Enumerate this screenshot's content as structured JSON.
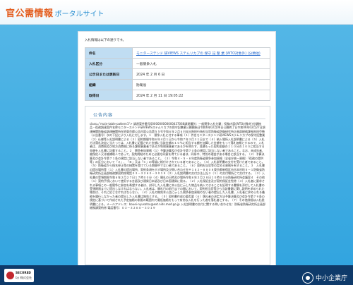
{
  "header": {
    "title_main": "官公需情報",
    "title_sub": "ポータルサイト"
  },
  "card": {
    "note": "入札情報は以下の通りです。",
    "rows": [
      {
        "key": "件名",
        "value": "モニターステンド 研VIEWS ステムリカプの 保守 記 整 業 (WTO対象外) (分類他)",
        "link": true
      },
      {
        "key": "入札区分",
        "value": "一般競争入札",
        "link": false
      },
      {
        "key": "公示日または更新日",
        "value": "2024 年 2 月 6 日",
        "link": false
      },
      {
        "key": "組織",
        "value": "防衛省",
        "link": false
      },
      {
        "key": "取得日",
        "value": "2024 年 2 月 11 日 19:05:22",
        "link": false
      }
    ],
    "content": {
      "title": "公告内容",
      "body": "class=\"main-table-pattern1\"> 調達案件番号0000000000000437068調達種別：一般競争入札分類：役務内容(WTO対象外)分類物品・役務調達案件名称モニターステンド研VIEWSステムリカプの保守記整業公開開始日令和6年02月06日公開終了日令和06年02月27日調達機関防衛省調達機関所在地東京都公告内容公告第５５号令和６年２月６日支出負担行為担当官防衛省防衛研究所企画部総務課長秋田壱勢（公告番号）次の下記により入札に付します。１　競争入札に付する事項（１）件名モニターステンド研VIEWSステムリカプの保守記整業（２）仕様等入札説明書による（３）契約期間令和６年４月１日から令和７年３月３１日まで（４）納入場所入札説明書による（５）入札方法落札決定に当たっては、入札書に記載された金額に当該金額の１０％に相当する額を加算した金額をもって落札価格とするので、入札者は、消費税及び地方消費税に係る課税事業者であるか免税事業者であるかを問わず、見積もった契約金額の１１０分の１００に相当する金額を入札書に記載すること。２　競争参加資格（１）予算決算及び会計令第７０条の規定に該当しない者であること。なお、未成年者、被保佐人又は被補助人であって、契約締結のために必要な同意を得ている者は、同条中、特別の理由がある場合に該当する。（２）予算決算及び会計令第７１条の規定に該当しない者であること。（３）令和４・５・６年度防衛省競争参加資格（全省庁統一資格）「役務の提供等」の区分において「Ａ」、「Ｂ」又は「Ｃ」の等級に格付けされている者であること。（４）入札説明書の交付を受けた者であること。（５）防衛省から指名停止等の措置を受けている期間中でない者であること。（６）契約担当官等の定める資格を有すること。３　入札書の提出場所等（１）入札書の提出場所、契約条項を示す場所及び問い合わせ先〒１６２－８８０８東京都新宿区市谷本村町５－１防衛省防衛研究所企画部総務課契約係電話０３－３２６０－３０１９（２）入札説明書の交付方法上記３（１）の交付場所にて交付する。（３）入札書の受領期限令和６年２月２７日１７時００分（４）開札の日時及び場所令和６年２月２８日１０時００分防衛研究所会議室４　その他（１）契約手続において使用する言語及び通貨日本語及び日本国通貨に限る。（２）入札保証金及び契約保証金免除（３）入札者に要求される事項この一般競争に参加を希望する者は、封印した入札書に本公告に示した物品を納入できることを証明する書類を添付して入札書の受領期限までに提出しなければならない。入札者は、開札日の前日までの間において、契約担当官等から当該書類に関し説明を求められた場合は、それに応じなければならない。（４）入札の無効本公告に示した競争参加資格のない者の提出した入札書、入札者に求められる義務を履行しなかった者の提出した入札書は無効とする。（５）契約書作成の要否要（６）落札者の決定方法予算決算及び会計令第７９条の規定に基づいて作成された予定価格の制限の範囲内で最低価格をもって有効な入札を行った者を落札者とする。（７）その他詳細は入札説明書による。メールアドレス：bouei-nyusatsu@ext.nids.mod.go.jp 入札説明書の交付に関する問い合わせ先：防衛省防衛研究所企画部総務課契約係 電話番号：０３－３２６０－３０１９"
    }
  },
  "footer": {
    "badge_title": "SECURED",
    "badge_sub": "by 株式会社",
    "agency_name": "中小企業庁"
  }
}
